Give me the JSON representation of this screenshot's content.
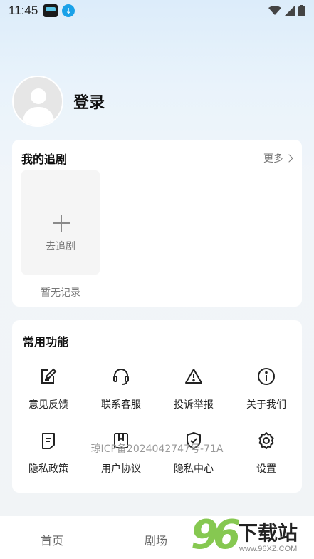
{
  "status_bar": {
    "time": "11:45"
  },
  "profile": {
    "login_label": "登录"
  },
  "my_drama": {
    "title": "我的追剧",
    "more_label": "更多",
    "add_label": "去追剧",
    "empty_label": "暂无记录"
  },
  "functions": {
    "title": "常用功能",
    "items": [
      {
        "label": "意见反馈",
        "icon": "feedback-icon"
      },
      {
        "label": "联系客服",
        "icon": "headset-icon"
      },
      {
        "label": "投诉举报",
        "icon": "warning-icon"
      },
      {
        "label": "关于我们",
        "icon": "info-icon"
      },
      {
        "label": "隐私政策",
        "icon": "document-icon"
      },
      {
        "label": "用户协议",
        "icon": "agreement-icon"
      },
      {
        "label": "隐私中心",
        "icon": "shield-icon"
      },
      {
        "label": "设置",
        "icon": "gear-icon"
      }
    ]
  },
  "icp_text": "琼ICP备2024042747号-71A",
  "tabbar": {
    "home": "首页",
    "theater": "剧场"
  },
  "watermark": {
    "digits": "96",
    "brand": "下载站",
    "url": "www.96XZ.COM"
  },
  "colors": {
    "accent_green": "#7ac33f",
    "card_bg": "#ffffff",
    "page_bg": "#f1f4f6"
  }
}
